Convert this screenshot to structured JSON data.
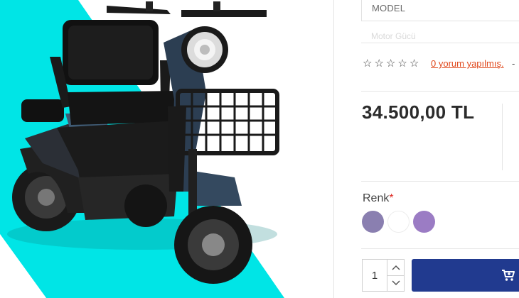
{
  "product": {
    "model_label": "MODEL",
    "model_sub": "Motor Gücü",
    "review_link": "0 yorum yapılmış.",
    "review_dash": "-",
    "price": "34.500,00 TL"
  },
  "rating": {
    "stars_filled": 0,
    "stars_total": 5
  },
  "variant": {
    "label": "Renk",
    "required_mark": "*",
    "swatches": [
      {
        "name": "lilac-gray",
        "color": "#8a7fb0"
      },
      {
        "name": "white",
        "color": "#ffffff"
      },
      {
        "name": "lavender",
        "color": "#9b7cc4"
      }
    ]
  },
  "purchase": {
    "quantity": "1",
    "cart_icon": "cart-icon",
    "button_color": "#213a8f"
  },
  "colors": {
    "accent_teal": "#00e5e6",
    "link": "#e0481c",
    "required": "#e0302a"
  }
}
